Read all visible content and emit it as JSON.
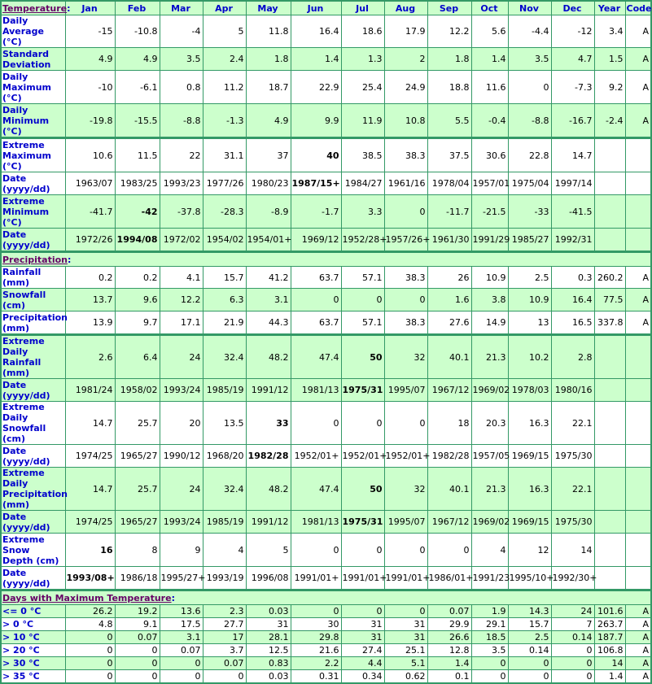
{
  "header": {
    "section_title": "Temperature",
    "columns": [
      "Jan",
      "Feb",
      "Mar",
      "Apr",
      "May",
      "Jun",
      "Jul",
      "Aug",
      "Sep",
      "Oct",
      "Nov",
      "Dec",
      "Year",
      "Code"
    ]
  },
  "sections": {
    "precipitation": "Precipitation",
    "days_max_temp": "Days with Maximum Temperature"
  },
  "rows": {
    "daily_average": {
      "label": "Daily Average (°C)",
      "values": [
        "-15",
        "-10.8",
        "-4",
        "5",
        "11.8",
        "16.4",
        "18.6",
        "17.9",
        "12.2",
        "5.6",
        "-4.4",
        "-12",
        "3.4",
        "A"
      ]
    },
    "std_dev": {
      "label": "Standard Deviation",
      "values": [
        "4.9",
        "4.9",
        "3.5",
        "2.4",
        "1.8",
        "1.4",
        "1.3",
        "2",
        "1.8",
        "1.4",
        "3.5",
        "4.7",
        "1.5",
        "A"
      ]
    },
    "daily_max": {
      "label": "Daily Maximum (°C)",
      "values": [
        "-10",
        "-6.1",
        "0.8",
        "11.2",
        "18.7",
        "22.9",
        "25.4",
        "24.9",
        "18.8",
        "11.6",
        "0",
        "-7.3",
        "9.2",
        "A"
      ]
    },
    "daily_min": {
      "label": "Daily Minimum (°C)",
      "values": [
        "-19.8",
        "-15.5",
        "-8.8",
        "-1.3",
        "4.9",
        "9.9",
        "11.9",
        "10.8",
        "5.5",
        "-0.4",
        "-8.8",
        "-16.7",
        "-2.4",
        "A"
      ]
    },
    "extreme_max": {
      "label": "Extreme Maximum (°C)",
      "values": [
        "10.6",
        "11.5",
        "22",
        "31.1",
        "37",
        "40",
        "38.5",
        "38.3",
        "37.5",
        "30.6",
        "22.8",
        "14.7",
        "",
        ""
      ],
      "bold_index": 5
    },
    "extreme_max_date": {
      "label": "Date (yyyy/dd)",
      "values": [
        "1963/07",
        "1983/25",
        "1993/23",
        "1977/26",
        "1980/23",
        "1987/15+",
        "1984/27",
        "1961/16",
        "1978/04",
        "1957/01",
        "1975/04",
        "1997/14",
        "",
        ""
      ],
      "bold_index": 5
    },
    "extreme_min": {
      "label": "Extreme Minimum (°C)",
      "values": [
        "-41.7",
        "-42",
        "-37.8",
        "-28.3",
        "-8.9",
        "-1.7",
        "3.3",
        "0",
        "-11.7",
        "-21.5",
        "-33",
        "-41.5",
        "",
        ""
      ],
      "bold_index": 1
    },
    "extreme_min_date": {
      "label": "Date (yyyy/dd)",
      "values": [
        "1972/26",
        "1994/08",
        "1972/02",
        "1954/02",
        "1954/01+",
        "1969/12",
        "1952/28+",
        "1957/26+",
        "1961/30",
        "1991/29",
        "1985/27",
        "1992/31",
        "",
        ""
      ],
      "bold_index": 1
    },
    "rainfall": {
      "label": "Rainfall (mm)",
      "values": [
        "0.2",
        "0.2",
        "4.1",
        "15.7",
        "41.2",
        "63.7",
        "57.1",
        "38.3",
        "26",
        "10.9",
        "2.5",
        "0.3",
        "260.2",
        "A"
      ]
    },
    "snowfall": {
      "label": "Snowfall (cm)",
      "values": [
        "13.7",
        "9.6",
        "12.2",
        "6.3",
        "3.1",
        "0",
        "0",
        "0",
        "1.6",
        "3.8",
        "10.9",
        "16.4",
        "77.5",
        "A"
      ]
    },
    "precipitation": {
      "label": "Precipitation (mm)",
      "values": [
        "13.9",
        "9.7",
        "17.1",
        "21.9",
        "44.3",
        "63.7",
        "57.1",
        "38.3",
        "27.6",
        "14.9",
        "13",
        "16.5",
        "337.8",
        "A"
      ]
    },
    "ext_daily_rain": {
      "label": "Extreme Daily Rainfall (mm)",
      "values": [
        "2.6",
        "6.4",
        "24",
        "32.4",
        "48.2",
        "47.4",
        "50",
        "32",
        "40.1",
        "21.3",
        "10.2",
        "2.8",
        "",
        ""
      ],
      "bold_index": 6
    },
    "ext_daily_rain_date": {
      "label": "Date (yyyy/dd)",
      "values": [
        "1981/24",
        "1958/02",
        "1993/24",
        "1985/19",
        "1991/12",
        "1981/13",
        "1975/31",
        "1995/07",
        "1967/12",
        "1969/02",
        "1978/03",
        "1980/16",
        "",
        ""
      ],
      "bold_index": 6
    },
    "ext_daily_snow": {
      "label": "Extreme Daily Snowfall (cm)",
      "values": [
        "14.7",
        "25.7",
        "20",
        "13.5",
        "33",
        "0",
        "0",
        "0",
        "18",
        "20.3",
        "16.3",
        "22.1",
        "",
        ""
      ],
      "bold_index": 4
    },
    "ext_daily_snow_date": {
      "label": "Date (yyyy/dd)",
      "values": [
        "1974/25",
        "1965/27",
        "1990/12",
        "1968/20",
        "1982/28",
        "1952/01+",
        "1952/01+",
        "1952/01+",
        "1982/28",
        "1957/05",
        "1969/15",
        "1975/30",
        "",
        ""
      ],
      "bold_index": 4
    },
    "ext_daily_precip": {
      "label": "Extreme Daily Precipitation (mm)",
      "values": [
        "14.7",
        "25.7",
        "24",
        "32.4",
        "48.2",
        "47.4",
        "50",
        "32",
        "40.1",
        "21.3",
        "16.3",
        "22.1",
        "",
        ""
      ],
      "bold_index": 6
    },
    "ext_daily_precip_date": {
      "label": "Date (yyyy/dd)",
      "values": [
        "1974/25",
        "1965/27",
        "1993/24",
        "1985/19",
        "1991/12",
        "1981/13",
        "1975/31",
        "1995/07",
        "1967/12",
        "1969/02",
        "1969/15",
        "1975/30",
        "",
        ""
      ],
      "bold_index": 6
    },
    "ext_snow_depth": {
      "label": "Extreme Snow Depth (cm)",
      "values": [
        "16",
        "8",
        "9",
        "4",
        "5",
        "0",
        "0",
        "0",
        "0",
        "4",
        "12",
        "14",
        "",
        ""
      ],
      "bold_index": 0
    },
    "ext_snow_depth_date": {
      "label": "Date (yyyy/dd)",
      "values": [
        "1993/08+",
        "1986/18",
        "1995/27+",
        "1993/19",
        "1996/08",
        "1991/01+",
        "1991/01+",
        "1991/01+",
        "1986/01+",
        "1991/23",
        "1995/10+",
        "1992/30+",
        "",
        ""
      ],
      "bold_index": 0
    },
    "le_0": {
      "label": "<= 0 °C",
      "values": [
        "26.2",
        "19.2",
        "13.6",
        "2.3",
        "0.03",
        "0",
        "0",
        "0",
        "0.07",
        "1.9",
        "14.3",
        "24",
        "101.6",
        "A"
      ]
    },
    "gt_0": {
      "label": "> 0 °C",
      "values": [
        "4.8",
        "9.1",
        "17.5",
        "27.7",
        "31",
        "30",
        "31",
        "31",
        "29.9",
        "29.1",
        "15.7",
        "7",
        "263.7",
        "A"
      ]
    },
    "gt_10": {
      "label": "> 10 °C",
      "values": [
        "0",
        "0.07",
        "3.1",
        "17",
        "28.1",
        "29.8",
        "31",
        "31",
        "26.6",
        "18.5",
        "2.5",
        "0.14",
        "187.7",
        "A"
      ]
    },
    "gt_20": {
      "label": "> 20 °C",
      "values": [
        "0",
        "0",
        "0.07",
        "3.7",
        "12.5",
        "21.6",
        "27.4",
        "25.1",
        "12.8",
        "3.5",
        "0.14",
        "0",
        "106.8",
        "A"
      ]
    },
    "gt_30": {
      "label": "> 30 °C",
      "values": [
        "0",
        "0",
        "0",
        "0.07",
        "0.83",
        "2.2",
        "4.4",
        "5.1",
        "1.4",
        "0",
        "0",
        "0",
        "14",
        "A"
      ]
    },
    "gt_35": {
      "label": "> 35 °C",
      "values": [
        "0",
        "0",
        "0",
        "0",
        "0.03",
        "0.31",
        "0.34",
        "0.62",
        "0.1",
        "0",
        "0",
        "0",
        "1.4",
        "A"
      ]
    }
  },
  "colors": {
    "border": "#339966",
    "green_bg": "#ccffcc",
    "label_text": "#0000cc",
    "section_link": "#660066"
  }
}
